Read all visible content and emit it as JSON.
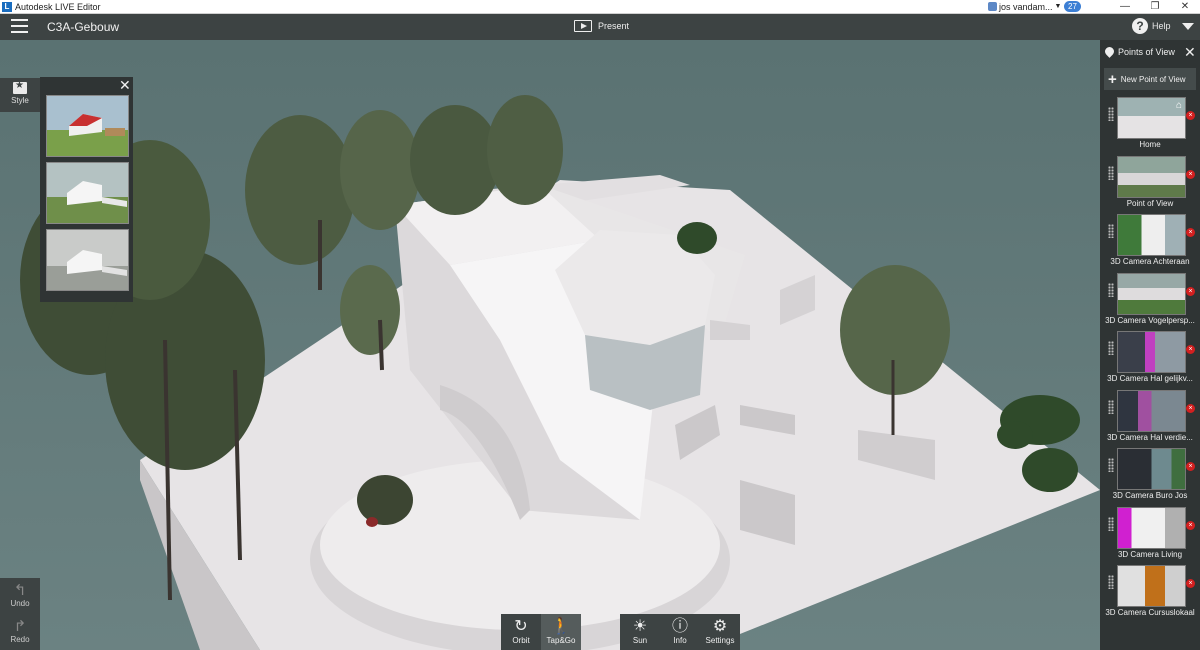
{
  "window": {
    "title": "Autodesk LIVE Editor",
    "app_icon": "L",
    "user_name": "jos vandam...",
    "notification_count": "27",
    "minimize_icon": "minimize-icon",
    "restore_icon": "restore-icon",
    "close_icon": "close-icon"
  },
  "toolbar": {
    "document_title": "C3A-Gebouw",
    "present_label": "Present",
    "help_label": "Help",
    "help_glyph": "?"
  },
  "style_panel": {
    "button_label": "Style",
    "close_glyph": "✕"
  },
  "history": {
    "undo_label": "Undo",
    "redo_label": "Redo",
    "undo_glyph": "↰",
    "redo_glyph": "↱"
  },
  "navigation": {
    "orbit_label": "Orbit",
    "tapgo_label": "Tap&Go",
    "sun_label": "Sun",
    "info_label": "Info",
    "settings_label": "Settings",
    "orbit_glyph": "↻",
    "tapgo_glyph": "🚶",
    "sun_glyph": "☀",
    "info_glyph": "ⓘ",
    "settings_glyph": "⚙"
  },
  "points_of_view": {
    "title": "Points of View",
    "close_glyph": "✕",
    "new_label": "New Point of View",
    "new_glyph": "+",
    "delete_glyph": "×",
    "home_glyph": "⌂",
    "items": [
      {
        "label": "Home"
      },
      {
        "label": "Point of View"
      },
      {
        "label": "3D Camera Achteraan"
      },
      {
        "label": "3D Camera Vogelpersp..."
      },
      {
        "label": "3D Camera Hal gelijkv..."
      },
      {
        "label": "3D Camera Hal verdie..."
      },
      {
        "label": "3D Camera Buro Jos"
      },
      {
        "label": "3D Camera Living"
      },
      {
        "label": "3D Camera Cursuslokaal"
      }
    ]
  },
  "colors": {
    "sky": "#5f7676",
    "panel": "#2f3434",
    "toolbar": "#3d4343",
    "accent_red": "#d32020"
  }
}
